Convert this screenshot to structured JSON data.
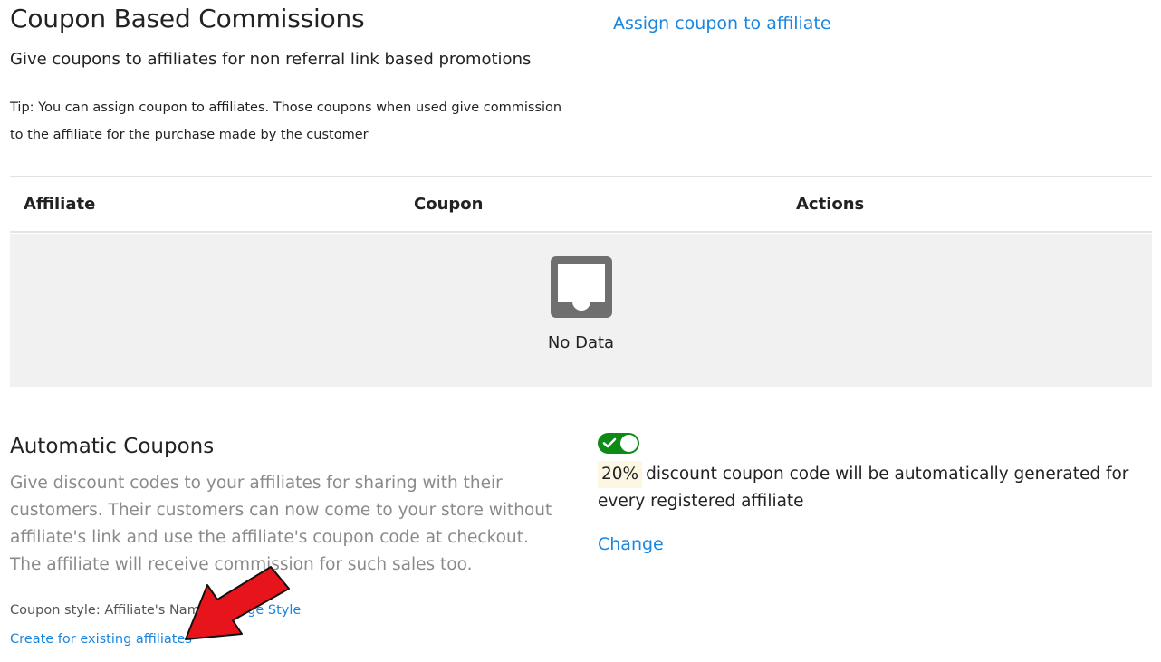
{
  "header": {
    "title": "Coupon Based Commissions",
    "subtitle": "Give coupons to affiliates for non referral link based promotions",
    "tip": "Tip: You can assign coupon to affiliates. Those coupons when used give commission to the affiliate for the purchase made by the customer",
    "assign_link": "Assign coupon to affiliate"
  },
  "table": {
    "columns": [
      "Affiliate",
      "Coupon",
      "Actions"
    ],
    "rows": [],
    "empty_text": "No Data",
    "empty_icon": "inbox-icon"
  },
  "automatic": {
    "title": "Automatic Coupons",
    "description": "Give discount codes to your affiliates for sharing with their customers. Their customers can now come to your store without affiliate's link and use the affiliate's coupon code at checkout. The affiliate will receive commission for such sales too.",
    "coupon_style_label": "Coupon style: Affiliate's Name",
    "change_style_link": "Change Style",
    "create_link": "Create for existing affiliates",
    "toggle_enabled": true,
    "discount_percent": "20%",
    "discount_text": "discount coupon code will be automatically generated for every registered affiliate",
    "change_link": "Change"
  },
  "colors": {
    "link": "#1a86e0",
    "toggle_on": "#0e8a16",
    "annotation_arrow": "#e8141c"
  }
}
